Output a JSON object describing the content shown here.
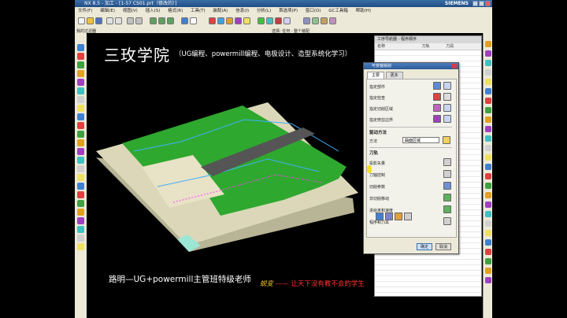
{
  "window": {
    "title": "NX 8.5 - 加工 - [1-57 CS01.prt（修改的）]",
    "brand": "SIEMENS"
  },
  "menu": [
    "文件(F)",
    "编辑(E)",
    "视图(V)",
    "插入(S)",
    "格式(R)",
    "工具(T)",
    "装配(A)",
    "信息(I)",
    "分析(L)",
    "首选项(P)",
    "窗口(O)",
    "GC工具箱",
    "帮助(H)"
  ],
  "status": {
    "left": "我的过滤器",
    "right": "选择: 任何 · 整个装配"
  },
  "banner": {
    "title": "三玫学院",
    "subtitle": "（UG编程、powermill编程、电极设计、造型系统化学习）"
  },
  "bottom_banner": "路明—UG+powermill主管班特级老师",
  "slogan": {
    "a": "蜕变",
    "dash": " —— ",
    "b": "让天下没有教不会的学生"
  },
  "nav": {
    "title": "工序导航器 - 程序顺序",
    "cols": [
      "名称",
      "刀轨",
      "刀具"
    ]
  },
  "dialog": {
    "title": "可变轴铣削",
    "tabs": [
      "主要",
      "更多"
    ],
    "rows": [
      "指定部件",
      "指定检查",
      "指定切削区域",
      "指定修剪边界"
    ],
    "section_method": "驱动方法",
    "method_label": "方法",
    "method_value": "曲面区域",
    "section_tool": "刀轨",
    "tool_rows": [
      "投影矢量",
      "刀轴控制",
      "切削参数",
      "非切削移动",
      "进给率和速度",
      "程序和刀具"
    ],
    "ok": "确定",
    "cancel": "取消"
  },
  "colors": {
    "accent": "#3a6ea5",
    "part_green": "#2fa82f",
    "part_base": "#d8d3b6",
    "banner_text": "#ffffff",
    "slogan_red": "#ff3030",
    "slogan_gold": "#f0c020"
  }
}
